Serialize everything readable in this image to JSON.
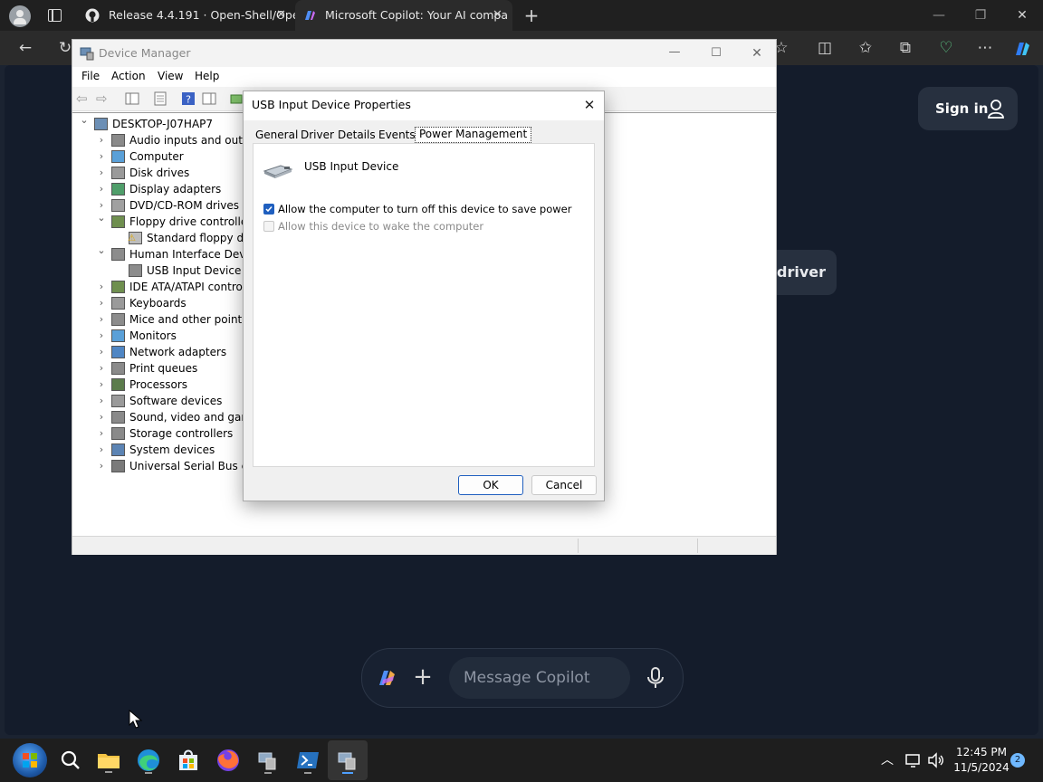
{
  "browser": {
    "tabs": [
      {
        "label": "Release 4.4.191 · Open-Shell/Ope",
        "active": false
      },
      {
        "label": "Microsoft Copilot: Your AI compa",
        "active": true
      }
    ],
    "new_tab": "+"
  },
  "copilot": {
    "sign_in": "Sign in",
    "chip_text": "driver",
    "composer_placeholder": "Message Copilot"
  },
  "device_manager": {
    "title": "Device Manager",
    "menu": [
      "File",
      "Action",
      "View",
      "Help"
    ],
    "tree": [
      {
        "label": "DESKTOP-J07HAP7",
        "level": 0,
        "expanded": true,
        "icon": "computer-icon"
      },
      {
        "label": "Audio inputs and outputs",
        "level": 1,
        "expanded": false,
        "icon": "audio-icon"
      },
      {
        "label": "Computer",
        "level": 1,
        "expanded": false,
        "icon": "monitor-icon"
      },
      {
        "label": "Disk drives",
        "level": 1,
        "expanded": false,
        "icon": "disk-icon"
      },
      {
        "label": "Display adapters",
        "level": 1,
        "expanded": false,
        "icon": "display-adapter-icon"
      },
      {
        "label": "DVD/CD-ROM drives",
        "level": 1,
        "expanded": false,
        "icon": "dvd-icon"
      },
      {
        "label": "Floppy drive controllers",
        "level": 1,
        "expanded": true,
        "icon": "controller-icon"
      },
      {
        "label": "Standard floppy disk controller",
        "level": 2,
        "icon": "warning-device-icon"
      },
      {
        "label": "Human Interface Devices",
        "level": 1,
        "expanded": true,
        "icon": "hid-icon"
      },
      {
        "label": "USB Input Device",
        "level": 2,
        "icon": "hid-icon"
      },
      {
        "label": "IDE ATA/ATAPI controllers",
        "level": 1,
        "expanded": false,
        "icon": "controller-icon"
      },
      {
        "label": "Keyboards",
        "level": 1,
        "expanded": false,
        "icon": "keyboard-icon"
      },
      {
        "label": "Mice and other pointing devices",
        "level": 1,
        "expanded": false,
        "icon": "mouse-icon"
      },
      {
        "label": "Monitors",
        "level": 1,
        "expanded": false,
        "icon": "monitor-icon"
      },
      {
        "label": "Network adapters",
        "level": 1,
        "expanded": false,
        "icon": "network-icon"
      },
      {
        "label": "Print queues",
        "level": 1,
        "expanded": false,
        "icon": "printer-icon"
      },
      {
        "label": "Processors",
        "level": 1,
        "expanded": false,
        "icon": "processor-icon"
      },
      {
        "label": "Software devices",
        "level": 1,
        "expanded": false,
        "icon": "software-device-icon"
      },
      {
        "label": "Sound, video and game controllers",
        "level": 1,
        "expanded": false,
        "icon": "audio-icon"
      },
      {
        "label": "Storage controllers",
        "level": 1,
        "expanded": false,
        "icon": "storage-icon"
      },
      {
        "label": "System devices",
        "level": 1,
        "expanded": false,
        "icon": "system-icon"
      },
      {
        "label": "Universal Serial Bus controllers",
        "level": 1,
        "expanded": false,
        "icon": "usb-icon"
      }
    ]
  },
  "dialog": {
    "title": "USB Input Device Properties",
    "tabs": [
      "General",
      "Driver",
      "Details",
      "Events",
      "Power Management"
    ],
    "active_tab": "Power Management",
    "device_name": "USB Input Device",
    "options": [
      {
        "label": "Allow the computer to turn off this device to save power",
        "checked": true,
        "enabled": true
      },
      {
        "label": "Allow this device to wake the computer",
        "checked": false,
        "enabled": false
      }
    ],
    "ok": "OK",
    "cancel": "Cancel"
  },
  "taskbar": {
    "time": "12:45 PM",
    "date": "11/5/2024",
    "notification_count": "2"
  }
}
